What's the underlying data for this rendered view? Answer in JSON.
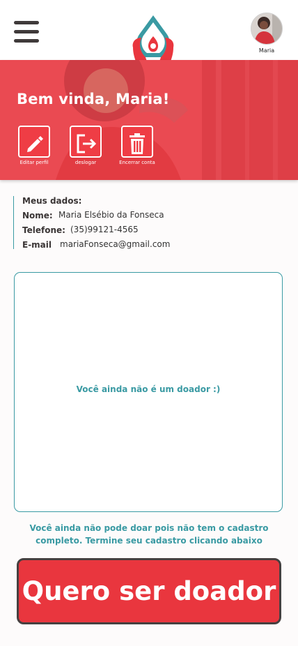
{
  "header": {
    "menu_icon": "hamburger-menu-icon",
    "logo_icon": "blood-drop-logo-icon",
    "profile_name": "Maria"
  },
  "hero": {
    "greeting": "Bem vinda, Maria!",
    "actions": [
      {
        "icon": "pencil-icon",
        "label": "Editar perfil"
      },
      {
        "icon": "logout-icon",
        "label": "deslogar"
      },
      {
        "icon": "trash-icon",
        "label": "Encerrar conta"
      }
    ]
  },
  "user_data": {
    "heading": "Meus dados:",
    "name_label": "Nome:",
    "name_value": "Maria Elsébio da Fonseca",
    "phone_label": "Telefone:",
    "phone_value": "(35)99121-4565",
    "email_label": "E-mail",
    "email_value": "mariaFonseca@gmail.com"
  },
  "donor_status": {
    "message": "Você ainda não é um doador :)"
  },
  "notice": {
    "line1": "Você ainda não pode doar pois não tem o cadastro",
    "line2": "completo. Termine seu cadastro clicando abaixo"
  },
  "cta": {
    "label": "Quero ser doador"
  },
  "colors": {
    "brand_red": "#e9363e",
    "brand_teal": "#3a9aa3",
    "dark": "#3f3a3a"
  }
}
